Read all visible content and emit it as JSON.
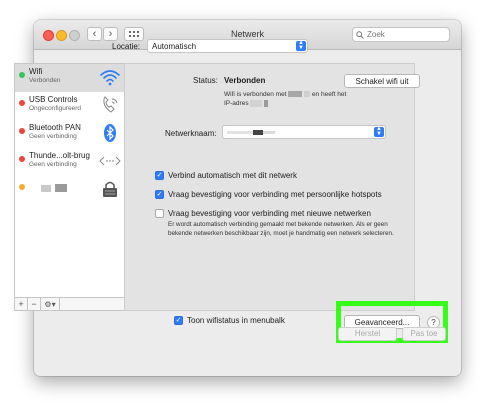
{
  "window": {
    "title": "Netwerk"
  },
  "search": {
    "placeholder": "Zoek"
  },
  "location": {
    "label": "Locatie:",
    "value": "Automatisch"
  },
  "services": [
    {
      "name": "Wifi",
      "status": "Verbonden",
      "dot_color": "#35c75a",
      "icon": "wifi-icon"
    },
    {
      "name": "USB Controls",
      "status": "Ongeconfigureerd",
      "dot_color": "#f0443b",
      "icon": "phone-icon"
    },
    {
      "name": "Bluetooth PAN",
      "status": "Geen verbinding",
      "dot_color": "#f0443b",
      "icon": "bluetooth-icon"
    },
    {
      "name": "Thunde...olt-brug",
      "status": "Geen verbinding",
      "dot_color": "#f0443b",
      "icon": "thunderbolt-bridge-icon"
    },
    {
      "name": "",
      "status": "",
      "dot_color": "#f7a932",
      "icon": "vpn-lock-icon"
    }
  ],
  "sidebar_tools": {
    "add": "+",
    "remove": "−",
    "gear": "⚙▾"
  },
  "status": {
    "label": "Status:",
    "value": "Verbonden",
    "button": "Schakel wifi uit",
    "desc_a": "Wifi is verbonden met",
    "desc_b": "en heeft het",
    "desc_c": "IP-adres"
  },
  "network_name": {
    "label": "Netwerknaam:"
  },
  "checkboxes": [
    {
      "label": "Verbind automatisch met dit netwerk",
      "checked": true
    },
    {
      "label": "Vraag bevestiging voor verbinding met persoonlijke hotspots",
      "checked": true
    },
    {
      "label": "Vraag bevestiging voor verbinding met nieuwe netwerken",
      "checked": false
    }
  ],
  "note": "Er wordt automatisch verbinding gemaakt met bekende netwerken. Als er geen bekende netwerken beschikbaar zijn, moet je handmatig een netwerk selecteren.",
  "menubar_checkbox": {
    "label": "Toon wifistatus in menubalk",
    "checked": true
  },
  "advanced_button": "Geavanceerd...",
  "help": "?",
  "footer": {
    "revert": "Herstel",
    "apply": "Pas toe"
  },
  "colors": {
    "accent": "#2f7cf6",
    "highlight": "#35ff18"
  }
}
